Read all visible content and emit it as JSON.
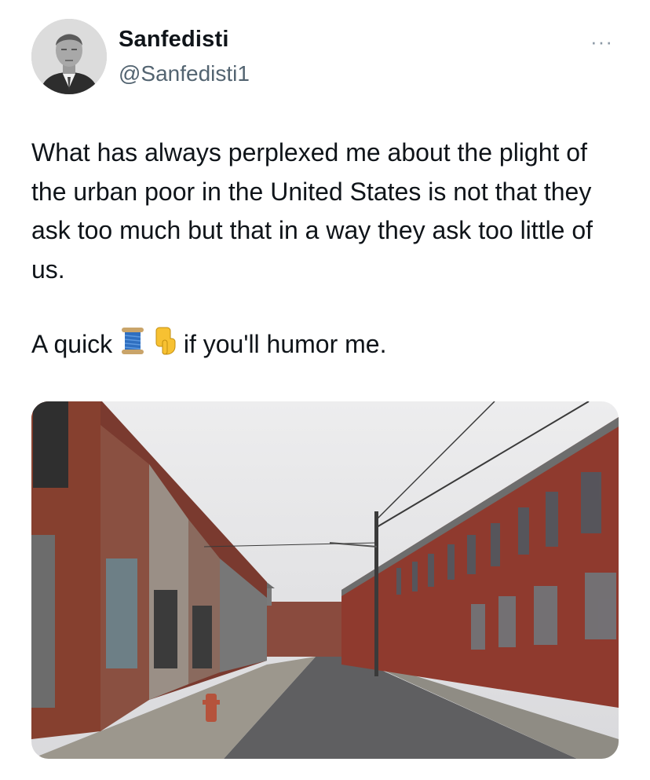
{
  "author": {
    "display_name": "Sanfedisti",
    "handle": "@Sanfedisti1",
    "avatar": "avatar-portrait"
  },
  "menu": {
    "icon": "more-horizontal-icon",
    "label": "···"
  },
  "tweet": {
    "paragraph1": "What has always perplexed me about the plight of the urban poor in the United States is not that they ask too much but that in a way they ask too little of us.",
    "line2_prefix": "A quick",
    "emoji_thread": "spool-of-thread-emoji",
    "emoji_pointer": "backhand-index-pointing-down-emoji",
    "line2_suffix": "if you'll humor me."
  },
  "media": {
    "type": "photo",
    "subject": "street-of-abandoned-brick-rowhouses"
  },
  "colors": {
    "text": "#0f1419",
    "secondary": "#536471",
    "brick": "#8e3b2e",
    "sky": "#e6e6e8",
    "road": "#5d5d5f"
  }
}
